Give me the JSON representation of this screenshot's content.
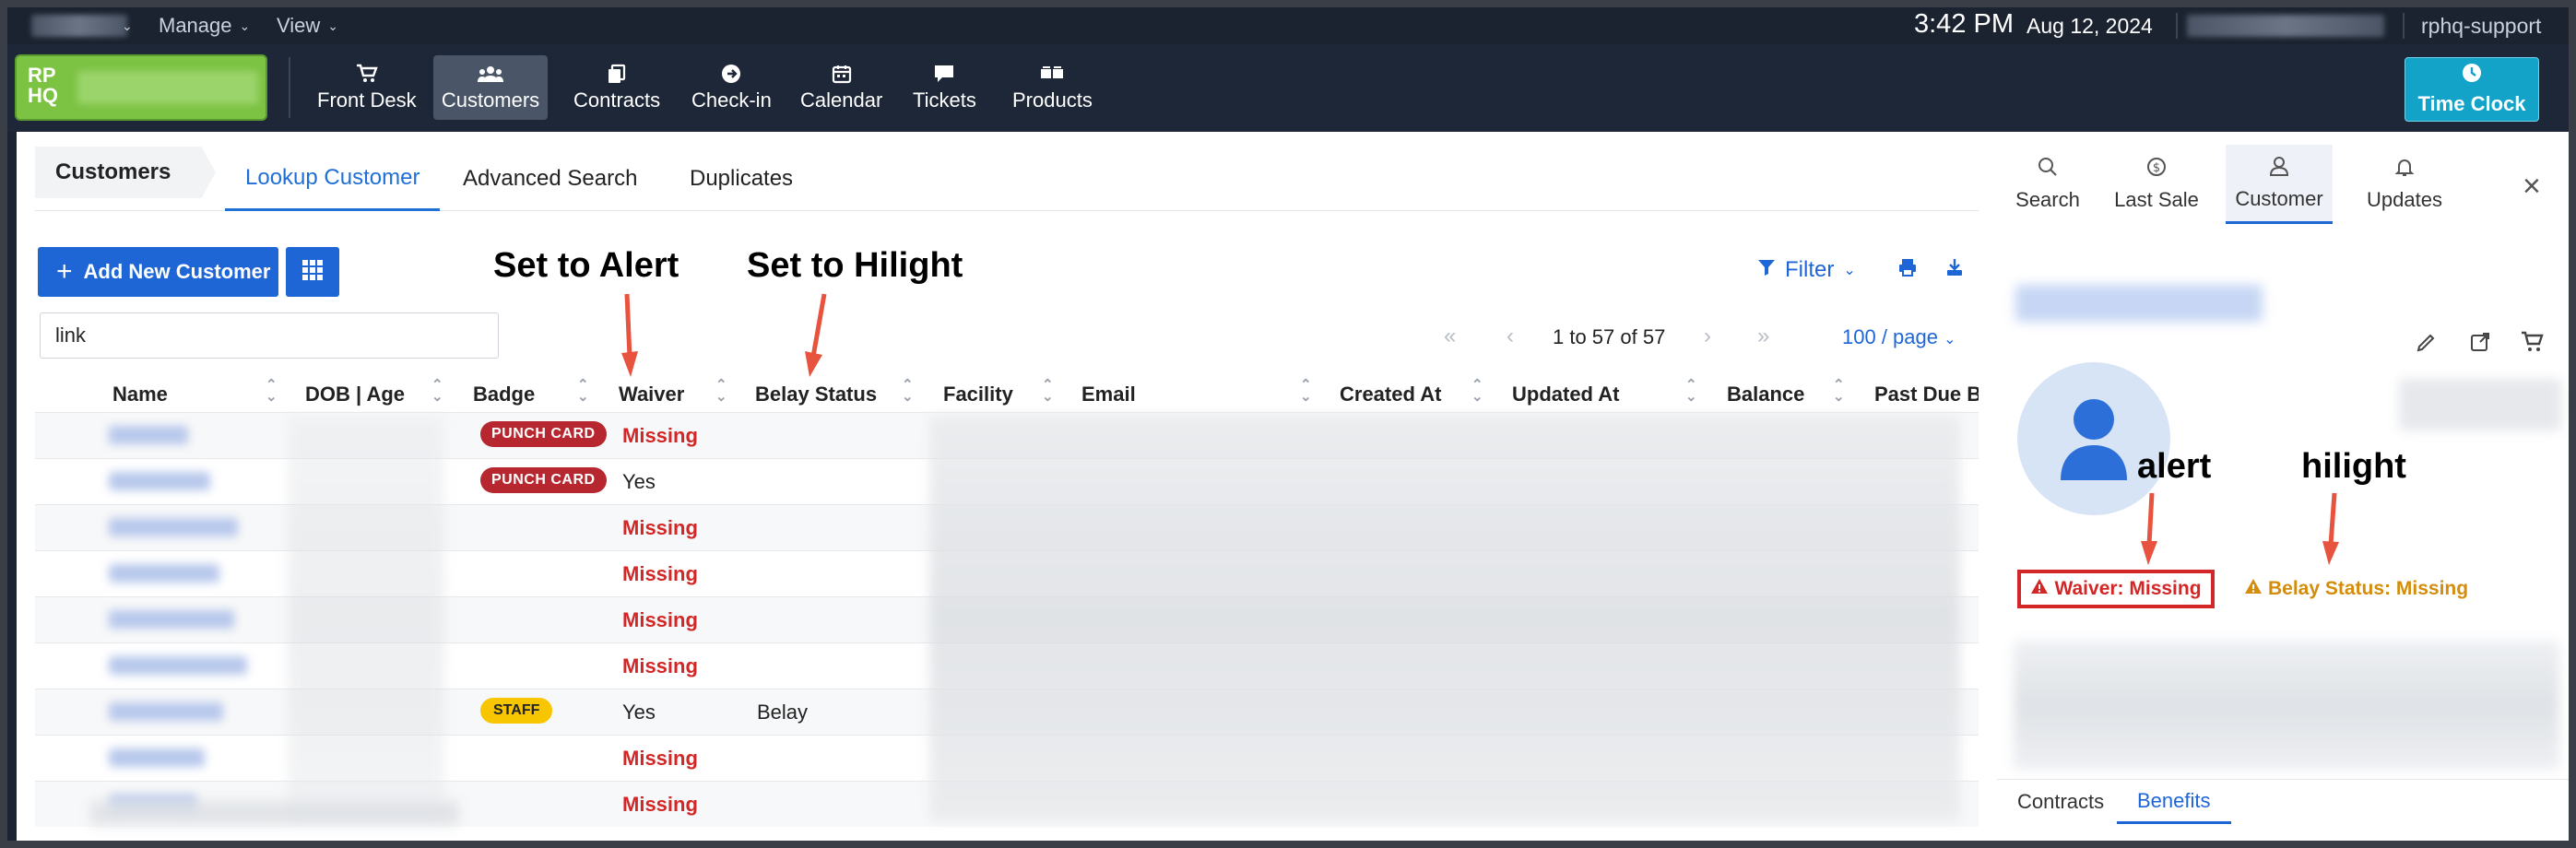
{
  "topbar": {
    "menus": [
      "Manage",
      "View"
    ],
    "time": "3:42 PM",
    "date": "Aug 12, 2024",
    "user": "rphq-support"
  },
  "navbar": {
    "logo_text": "RP HQ",
    "items": [
      {
        "label": "Front Desk",
        "icon": "cart-icon"
      },
      {
        "label": "Customers",
        "icon": "users-icon",
        "active": true
      },
      {
        "label": "Contracts",
        "icon": "contracts-icon"
      },
      {
        "label": "Check-in",
        "icon": "arrow-circle-icon"
      },
      {
        "label": "Calendar",
        "icon": "calendar-icon"
      },
      {
        "label": "Tickets",
        "icon": "chat-icon"
      },
      {
        "label": "Products",
        "icon": "boxes-icon"
      }
    ],
    "time_clock": "Time Clock"
  },
  "main": {
    "breadcrumb": "Customers",
    "tabs": [
      "Lookup Customer",
      "Advanced Search",
      "Duplicates"
    ],
    "add_button": "Add New Customer",
    "search_value": "link",
    "annotations": {
      "alert": "Set to Alert",
      "hilight": "Set to Hilight"
    },
    "filter_label": "Filter",
    "pager": {
      "range": "1 to 57 of 57",
      "per_page": "100 / page"
    },
    "columns": [
      "Name",
      "DOB | Age",
      "Badge",
      "Waiver",
      "Belay Status",
      "Facility",
      "Email",
      "Created At",
      "Updated At",
      "Balance",
      "Past Due Bala"
    ],
    "rows": [
      {
        "badge": "PUNCH CARD",
        "waiver": "Missing",
        "belay": ""
      },
      {
        "badge": "PUNCH CARD",
        "waiver": "Yes",
        "belay": ""
      },
      {
        "badge": "",
        "waiver": "Missing",
        "belay": ""
      },
      {
        "badge": "",
        "waiver": "Missing",
        "belay": ""
      },
      {
        "badge": "",
        "waiver": "Missing",
        "belay": ""
      },
      {
        "badge": "",
        "waiver": "Missing",
        "belay": ""
      },
      {
        "badge": "STAFF",
        "waiver": "Yes",
        "belay": "Belay"
      },
      {
        "badge": "",
        "waiver": "Missing",
        "belay": ""
      },
      {
        "badge": "",
        "waiver": "Missing",
        "belay": ""
      }
    ]
  },
  "panel": {
    "tabs": [
      "Search",
      "Last Sale",
      "Customer",
      "Updates"
    ],
    "annotations": {
      "alert": "alert",
      "hilight": "hilight"
    },
    "waiver_status": "Waiver: Missing",
    "belay_status": "Belay Status: Missing",
    "bottom_tabs": [
      "Contracts",
      "Benefits"
    ]
  },
  "colors": {
    "primary": "#1e66d6",
    "alert": "#d32626",
    "hilight": "#d38c0b",
    "logo": "#7cc243",
    "timeclock": "#13a3c9"
  }
}
